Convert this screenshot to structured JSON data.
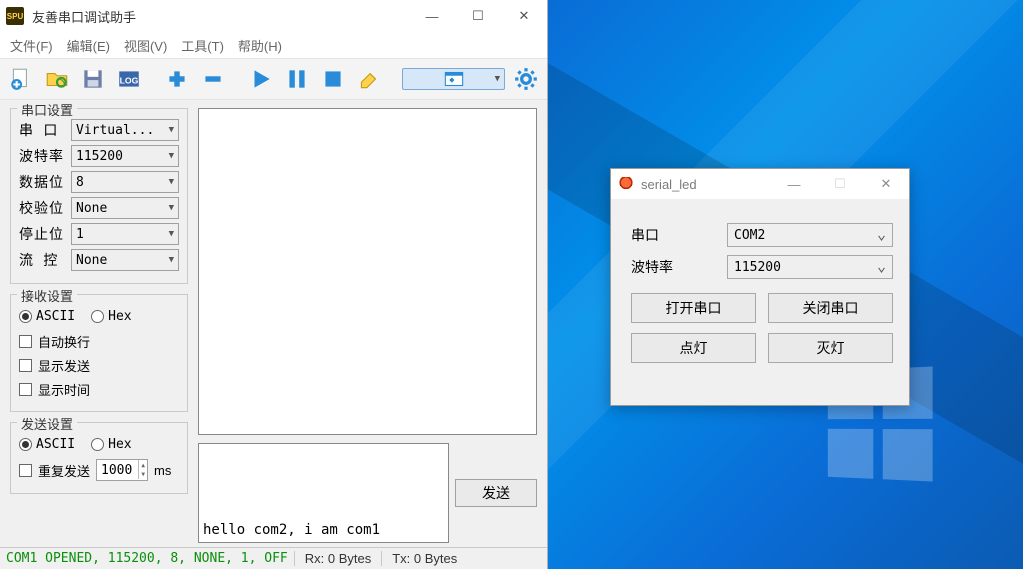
{
  "main": {
    "title": "友善串口调试助手",
    "menu": {
      "file": "文件(F)",
      "edit": "编辑(E)",
      "view": "视图(V)",
      "tools": "工具(T)",
      "help": "帮助(H)"
    },
    "port_group": {
      "legend": "串口设置",
      "rows": {
        "port": {
          "label": "串  口",
          "value": "Virtual..."
        },
        "baud": {
          "label": "波特率",
          "value": "115200"
        },
        "data": {
          "label": "数据位",
          "value": "8"
        },
        "parity": {
          "label": "校验位",
          "value": "None"
        },
        "stop": {
          "label": "停止位",
          "value": "1"
        },
        "flow": {
          "label": "流  控",
          "value": "None"
        }
      }
    },
    "rx_group": {
      "legend": "接收设置",
      "ascii": "ASCII",
      "hex": "Hex",
      "autowrap": "自动换行",
      "showtx": "显示发送",
      "showtime": "显示时间"
    },
    "tx_group": {
      "legend": "发送设置",
      "ascii": "ASCII",
      "hex": "Hex",
      "repeat": "重复发送",
      "interval": "1000",
      "ms": "ms"
    },
    "send_label": "发送",
    "tx_value": "hello com2, i am com1",
    "status": {
      "conn": "COM1 OPENED, 115200, 8, NONE, 1, OFF",
      "rx": "Rx: 0 Bytes",
      "tx": "Tx: 0 Bytes"
    }
  },
  "led": {
    "title": "serial_led",
    "port_label": "串口",
    "port_value": "COM2",
    "baud_label": "波特率",
    "baud_value": "115200",
    "open": "打开串口",
    "close": "关闭串口",
    "on": "点灯",
    "off": "灭灯"
  }
}
